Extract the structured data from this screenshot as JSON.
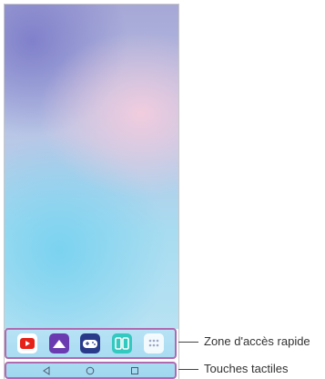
{
  "dock": {
    "apps": [
      {
        "icon": "youtube-icon"
      },
      {
        "icon": "gallery-icon"
      },
      {
        "icon": "game-launcher-icon"
      },
      {
        "icon": "smartworld-icon"
      },
      {
        "icon": "apps-drawer-icon"
      }
    ]
  },
  "nav": {
    "buttons": [
      {
        "icon": "back-icon"
      },
      {
        "icon": "home-icon"
      },
      {
        "icon": "recents-icon"
      }
    ]
  },
  "callouts": {
    "dock_label": "Zone d'accès rapide",
    "nav_label": "Touches tactiles"
  },
  "colors": {
    "highlight": "#b06ab0"
  }
}
